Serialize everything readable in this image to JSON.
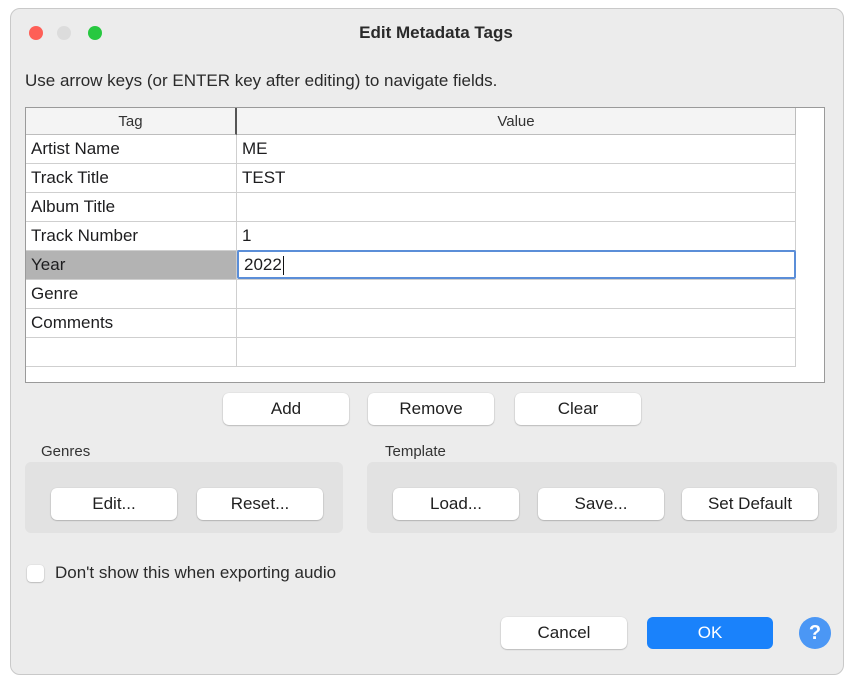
{
  "window": {
    "title": "Edit Metadata Tags",
    "instructions": "Use arrow keys (or ENTER key after editing) to navigate fields."
  },
  "grid": {
    "headers": {
      "tag": "Tag",
      "value": "Value"
    },
    "rows": [
      {
        "tag": "Artist Name",
        "value": "ME"
      },
      {
        "tag": "Track Title",
        "value": "TEST"
      },
      {
        "tag": "Album Title",
        "value": ""
      },
      {
        "tag": "Track Number",
        "value": "1"
      },
      {
        "tag": "Year",
        "value": "2022"
      },
      {
        "tag": "Genre",
        "value": ""
      },
      {
        "tag": "Comments",
        "value": ""
      },
      {
        "tag": "",
        "value": ""
      }
    ],
    "selected_row": "Year"
  },
  "row_buttons": {
    "add": "Add",
    "remove": "Remove",
    "clear": "Clear"
  },
  "genres": {
    "label": "Genres",
    "edit": "Edit...",
    "reset": "Reset..."
  },
  "template": {
    "label": "Template",
    "load": "Load...",
    "save": "Save...",
    "set_default": "Set Default"
  },
  "options": {
    "dont_show_label": "Don't show this when exporting audio",
    "dont_show_checked": false
  },
  "footer": {
    "cancel": "Cancel",
    "ok": "OK",
    "help_glyph": "?"
  },
  "colors": {
    "accent": "#1a82fb",
    "selection": "#b3b3b3",
    "focus_ring": "#5b8ed8"
  },
  "icons": {
    "close": "close-dot",
    "minimize": "minimize-dot",
    "maximize": "maximize-dot",
    "help": "help-icon"
  }
}
